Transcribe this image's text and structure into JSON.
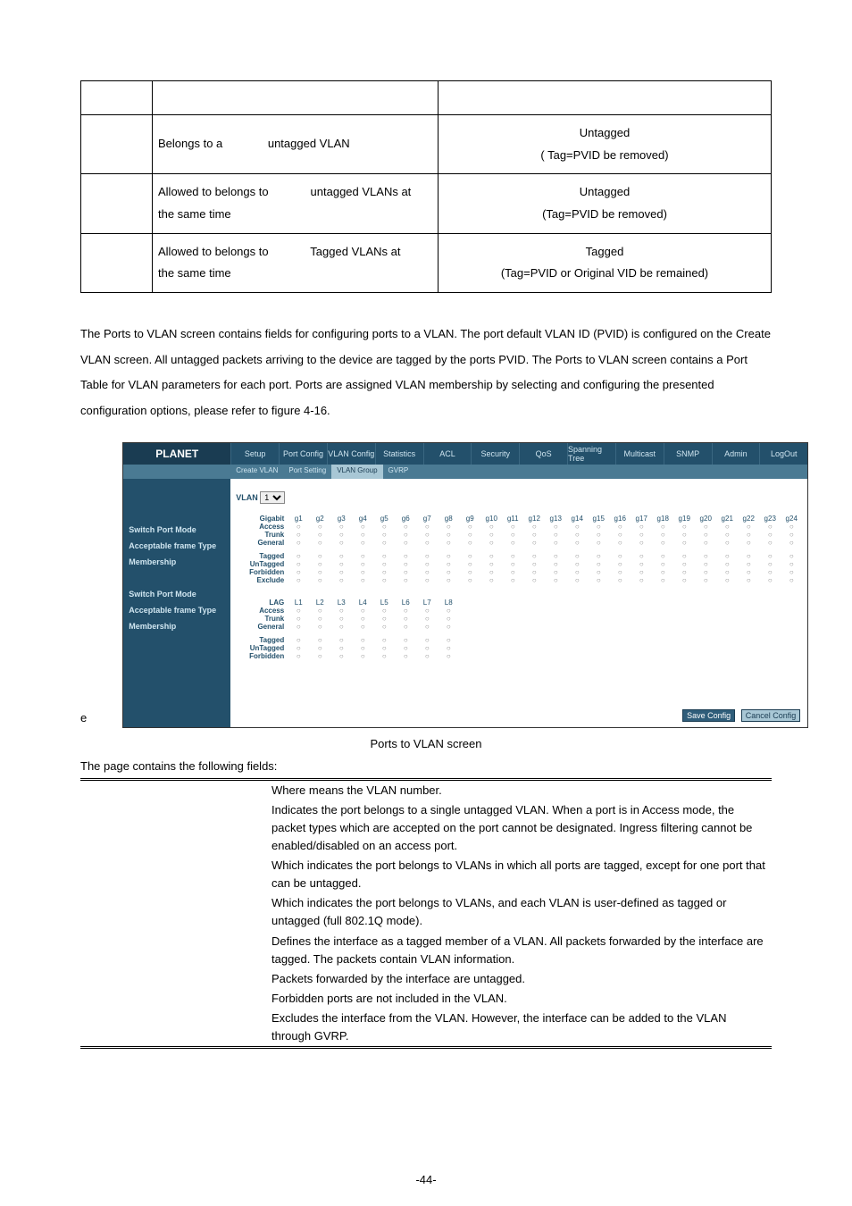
{
  "port_table": {
    "rows": [
      {
        "left": "",
        "mid": "",
        "right": ""
      },
      {
        "left": "",
        "mid": "Belongs to a              untagged VLAN",
        "right": "Untagged\n( Tag=PVID be removed)"
      },
      {
        "left": "",
        "mid": "Allowed to belongs to             untagged VLANs at\nthe same time",
        "right": "Untagged\n(Tag=PVID be removed)"
      },
      {
        "left": "",
        "mid": "Allowed to belongs to             Tagged VLANs at\nthe same time",
        "right": "Tagged\n(Tag=PVID or Original VID be remained)"
      }
    ]
  },
  "intro_paragraph": "The Ports to VLAN screen contains fields for configuring ports to a VLAN. The port default VLAN ID (PVID) is configured on the Create VLAN screen. All untagged packets arriving to the device are tagged by the ports PVID. The Ports to VLAN screen contains a Port Table for VLAN parameters for each port. Ports are assigned VLAN membership by selecting and configuring the presented configuration options, please refer to figure 4-16.",
  "ui": {
    "logo": "PLANET",
    "tabs": [
      "Setup",
      "Port Config",
      "VLAN Config",
      "Statistics",
      "ACL",
      "Security",
      "QoS",
      "Spanning Tree",
      "Multicast",
      "SNMP",
      "Admin",
      "LogOut"
    ],
    "sub_tabs": [
      "Create VLAN",
      "Port Setting",
      "VLAN Group",
      "GVRP"
    ],
    "vlan_label": "VLAN",
    "vlan_value": "1",
    "side_groups": [
      [
        "Switch Port Mode",
        "Acceptable frame Type",
        "Membership"
      ],
      [
        "Switch Port Mode",
        "Acceptable frame Type",
        "Membership"
      ]
    ],
    "gig_header_label": "Gigabit",
    "gig_cols": [
      "g1",
      "g2",
      "g3",
      "g4",
      "g5",
      "g6",
      "g7",
      "g8",
      "g9",
      "g10",
      "g11",
      "g12",
      "g13",
      "g14",
      "g15",
      "g16",
      "g17",
      "g18",
      "g19",
      "g20",
      "g21",
      "g22",
      "g23",
      "g24"
    ],
    "mode_rows_g": [
      "Access",
      "Trunk",
      "General"
    ],
    "mem_rows_g": [
      "Tagged",
      "UnTagged",
      "Forbidden",
      "Exclude"
    ],
    "lag_header_label": "LAG",
    "lag_cols": [
      "L1",
      "L2",
      "L3",
      "L4",
      "L5",
      "L6",
      "L7",
      "L8"
    ],
    "mode_rows_l": [
      "Access",
      "Trunk",
      "General"
    ],
    "mem_rows_l": [
      "Tagged",
      "UnTagged",
      "Forbidden"
    ],
    "save_btn": "Save Config",
    "cancel_btn": "Cancel Config"
  },
  "figure_caption": "Ports to VLAN screen",
  "fields_intro": "The page contains the following fields:",
  "fields": [
    {
      "label": "",
      "desc": "Where means the VLAN number."
    },
    {
      "label": "",
      "desc": "Indicates the port belongs to a single untagged VLAN. When a port is in Access mode, the packet types which are accepted on the port cannot be designated. Ingress filtering cannot be enabled/disabled on an access port."
    },
    {
      "label": "",
      "desc": "Which indicates the port belongs to VLANs in which all ports are tagged, except for one port that can be untagged."
    },
    {
      "label": "",
      "desc": "Which indicates the port belongs to VLANs, and each VLAN is user-defined as tagged or untagged (full 802.1Q mode)."
    },
    {
      "label": "",
      "desc": "Defines the interface as a tagged member of a VLAN. All packets forwarded by the interface are tagged. The packets contain VLAN information."
    },
    {
      "label": "",
      "desc": "Packets forwarded by the interface are untagged."
    },
    {
      "label": "",
      "desc": "Forbidden ports are not included in the VLAN."
    },
    {
      "label": "",
      "desc": "Excludes the interface from the VLAN. However, the interface can be added to the VLAN through GVRP."
    }
  ],
  "page_number": "-44-"
}
